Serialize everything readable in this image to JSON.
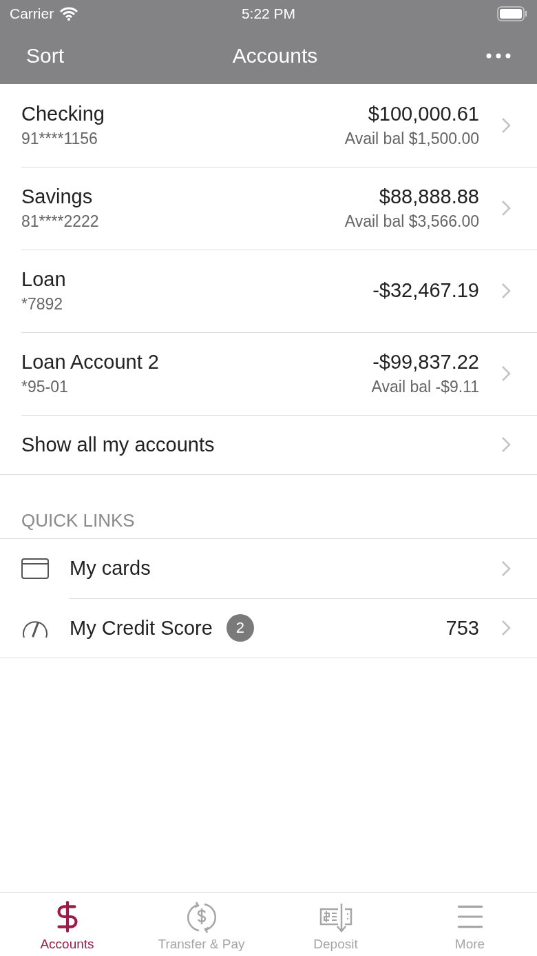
{
  "status_bar": {
    "carrier": "Carrier",
    "time": "5:22 PM"
  },
  "nav": {
    "left": "Sort",
    "title": "Accounts"
  },
  "accounts": [
    {
      "name": "Checking",
      "number": "91****1156",
      "balance": "$100,000.61",
      "available": "Avail bal $1,500.00"
    },
    {
      "name": "Savings",
      "number": "81****2222",
      "balance": "$88,888.88",
      "available": "Avail bal $3,566.00"
    },
    {
      "name": "Loan",
      "number": "*7892",
      "balance": "-$32,467.19"
    },
    {
      "name": "Loan Account 2",
      "number": "*95-01",
      "balance": "-$99,837.22",
      "available": "Avail bal -$9.11"
    }
  ],
  "show_all": "Show all my accounts",
  "quick_links": {
    "title": "QUICK LINKS",
    "items": [
      {
        "kind": "card",
        "label": "My cards"
      },
      {
        "kind": "gauge",
        "label": "My Credit Score",
        "badge": "2",
        "value": "753"
      }
    ]
  },
  "tab_bar": [
    {
      "kind": "dollar",
      "label": "Accounts",
      "selected": true
    },
    {
      "kind": "transfer",
      "label": "Transfer & Pay",
      "selected": false
    },
    {
      "kind": "deposit",
      "label": "Deposit",
      "selected": false
    },
    {
      "kind": "menu",
      "label": "More",
      "selected": false
    }
  ]
}
